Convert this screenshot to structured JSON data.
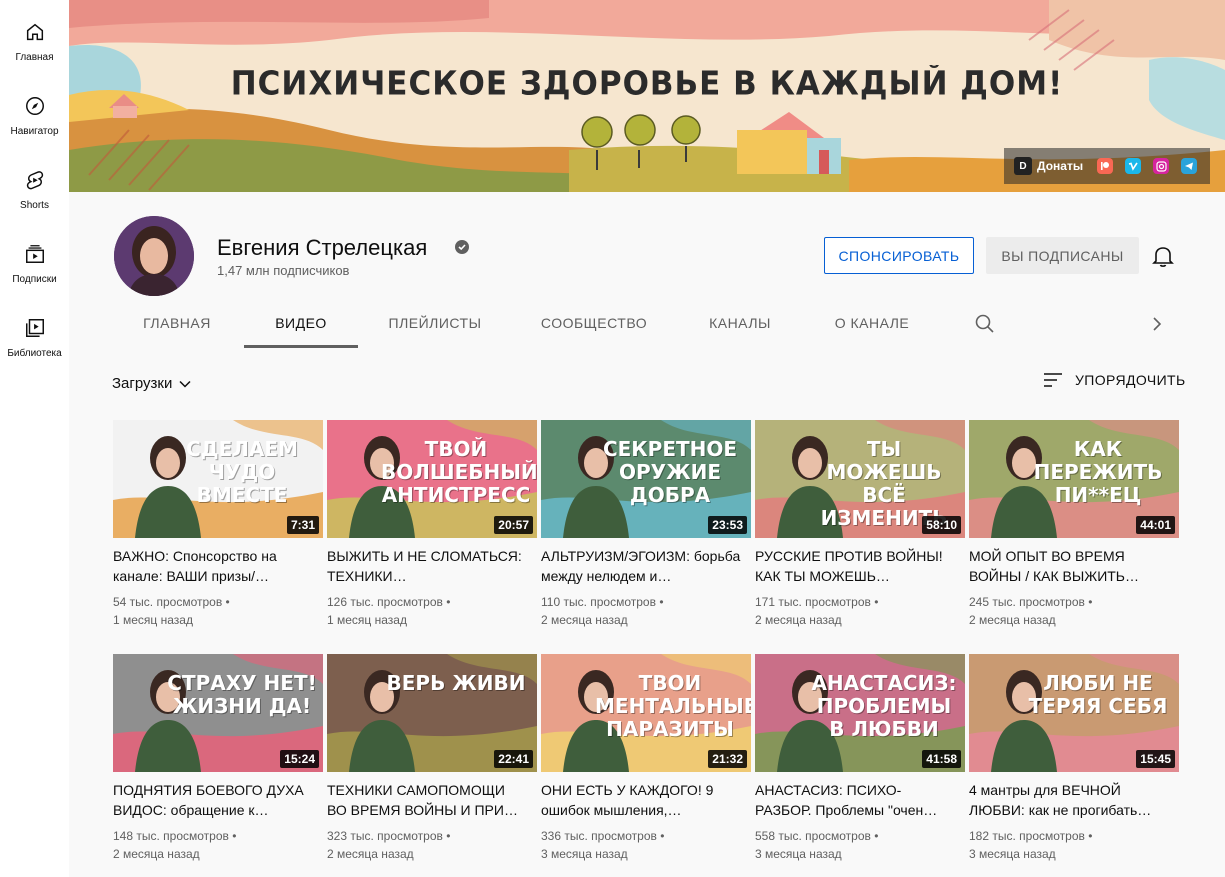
{
  "sidebar": {
    "items": [
      {
        "label": "Главная",
        "icon": "home-icon"
      },
      {
        "label": "Навигатор",
        "icon": "compass-icon"
      },
      {
        "label": "Shorts",
        "icon": "shorts-icon"
      },
      {
        "label": "Подписки",
        "icon": "subscriptions-icon"
      },
      {
        "label": "Библиотека",
        "icon": "library-icon"
      }
    ]
  },
  "banner": {
    "title": "ПСИХИЧЕСКОЕ ЗДОРОВЬЕ В КАЖДЫЙ ДОМ!",
    "donate_label": "Донаты",
    "donate_icon_text": "D",
    "links": [
      "patreon-icon",
      "vimeo-icon",
      "instagram-icon",
      "telegram-icon"
    ]
  },
  "channel": {
    "name": "Евгения Стрелецкая",
    "subscribers": "1,47 млн подписчиков",
    "sponsor_label": "СПОНСИРОВАТЬ",
    "subscribed_label": "ВЫ ПОДПИСАНЫ",
    "tabs": [
      "ГЛАВНАЯ",
      "ВИДЕО",
      "ПЛЕЙЛИСТЫ",
      "СООБЩЕСТВО",
      "КАНАЛЫ",
      "О КАНАЛЕ"
    ],
    "active_tab": "ВИДЕО"
  },
  "content": {
    "filter_label": "Загрузки",
    "sort_label": "УПОРЯДОЧИТЬ"
  },
  "videos": [
    {
      "title": "ВАЖНО: Спонсорство на канале: ВАШИ призы/…",
      "views": "54 тыс. просмотров",
      "age": "1 месяц назад",
      "duration": "7:31",
      "thumb_text": "СДЕЛАЕМ ЧУДО ВМЕСТЕ",
      "bg": "#f2f2f2",
      "accent": "#e8a24a"
    },
    {
      "title": "ВЫЖИТЬ И НЕ СЛОМАТЬСЯ: ТЕХНИКИ…",
      "views": "126 тыс. просмотров",
      "age": "1 месяц назад",
      "duration": "20:57",
      "thumb_text": "ТВОЙ ВОЛШЕБНЫЙ АНТИСТРЕСС",
      "bg": "#e9728a",
      "accent": "#c9c25a"
    },
    {
      "title": "АЛЬТРУИЗМ/ЭГОИЗМ: борьба между нелюдем и…",
      "views": "110 тыс. просмотров",
      "age": "2 месяца назад",
      "duration": "23:53",
      "thumb_text": "СЕКРЕТНОЕ ОРУЖИЕ ДОБРА",
      "bg": "#5c8a6e",
      "accent": "#67b8c9"
    },
    {
      "title": "РУССКИЕ ПРОТИВ ВОЙНЫ! КАК ТЫ МОЖЕШЬ…",
      "views": "171 тыс. просмотров",
      "age": "2 месяца назад",
      "duration": "58:10",
      "thumb_text": "ТЫ МОЖЕШЬ ВСЁ ИЗМЕНИТЬ",
      "bg": "#b5b27a",
      "accent": "#e27e7e"
    },
    {
      "title": "МОЙ ОПЫТ ВО ВРЕМЯ ВОЙНЫ / КАК ВЫЖИТЬ…",
      "views": "245 тыс. просмотров",
      "age": "2 месяца назад",
      "duration": "44:01",
      "thumb_text": "КАК ПЕРЕЖИТЬ ПИ**ЕЦ",
      "bg": "#9fa86a",
      "accent": "#e58a8a"
    },
    {
      "title": "ПОДНЯТИЯ БОЕВОГО ДУХА ВИДОС: обращение к…",
      "views": "148 тыс. просмотров",
      "age": "2 месяца назад",
      "duration": "15:24",
      "thumb_text": "СТРАХУ НЕТ! ЖИЗНИ ДА!",
      "bg": "#8f8f8f",
      "accent": "#e8617a"
    },
    {
      "title": "ТЕХНИКИ САМОПОМОЩИ ВО ВРЕМЯ ВОЙНЫ И ПРИ…",
      "views": "323 тыс. просмотров",
      "age": "2 месяца назад",
      "duration": "22:41",
      "thumb_text": "ВЕРЬ ЖИВИ",
      "bg": "#7d5f4e",
      "accent": "#a59a4c"
    },
    {
      "title": "ОНИ ЕСТЬ У КАЖДОГО! 9 ошибок мышления,…",
      "views": "336 тыс. просмотров",
      "age": "3 месяца назад",
      "duration": "21:32",
      "thumb_text": "ТВОИ МЕНТАЛЬНЫЕ ПАРАЗИТЫ",
      "bg": "#e8a08a",
      "accent": "#f0d070"
    },
    {
      "title": "АНАСТАСИЗ: ПСИХО-РАЗБОР. Проблемы \"очен…",
      "views": "558 тыс. просмотров",
      "age": "3 месяца назад",
      "duration": "41:58",
      "thumb_text": "АНАСТАСИЗ: ПРОБЛЕМЫ В ЛЮБВИ",
      "bg": "#c96f88",
      "accent": "#7a9c52"
    },
    {
      "title": "4 мантры для ВЕЧНОЙ ЛЮБВИ: как не прогибать…",
      "views": "182 тыс. просмотров",
      "age": "3 месяца назад",
      "duration": "15:45",
      "thumb_text": "ЛЮБИ НЕ ТЕРЯЯ СЕБЯ",
      "bg": "#c99a72",
      "accent": "#e58896"
    }
  ]
}
